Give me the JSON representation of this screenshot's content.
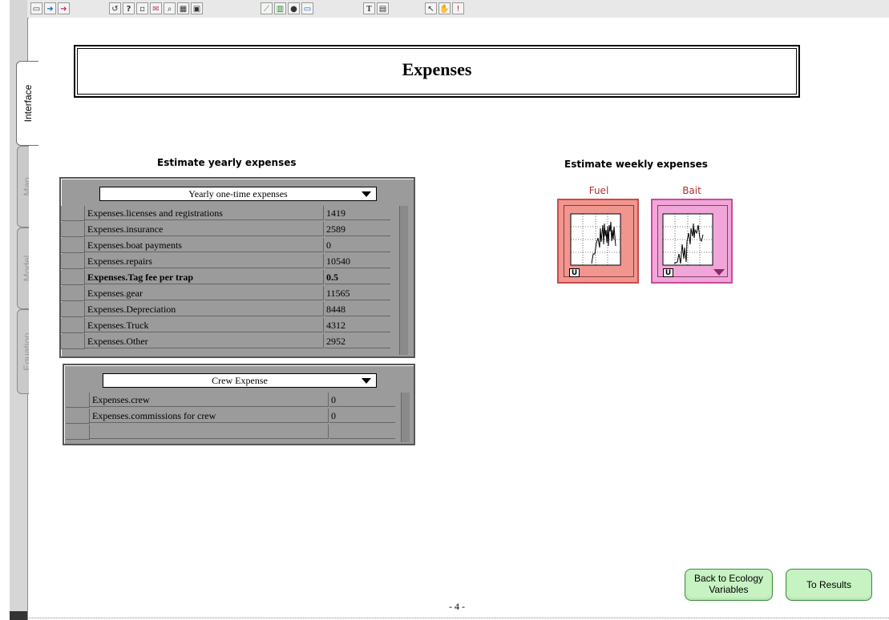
{
  "tabs": [
    {
      "label": "Interface",
      "active": true
    },
    {
      "label": "Map",
      "active": false
    },
    {
      "label": "Model",
      "active": false
    },
    {
      "label": "Equation",
      "active": false
    }
  ],
  "title": "Expenses",
  "yearly": {
    "heading": "Estimate yearly expenses",
    "selector": "Yearly one-time expenses",
    "rows": [
      {
        "name": "Expenses.licenses and registrations",
        "value": "1419"
      },
      {
        "name": "Expenses.insurance",
        "value": "2589"
      },
      {
        "name": "Expenses.boat payments",
        "value": "0"
      },
      {
        "name": "Expenses.repairs",
        "value": "10540"
      },
      {
        "name": "Expenses.Tag fee per trap",
        "value": "0.5"
      },
      {
        "name": "Expenses.gear",
        "value": "11565"
      },
      {
        "name": "Expenses.Depreciation",
        "value": "8448"
      },
      {
        "name": "Expenses.Truck",
        "value": "4312"
      },
      {
        "name": "Expenses.Other",
        "value": "2952"
      }
    ]
  },
  "crew": {
    "selector": "Crew Expense",
    "rows": [
      {
        "name": "Expenses.crew",
        "value": "0"
      },
      {
        "name": "Expenses.commissions for crew",
        "value": "0"
      }
    ]
  },
  "weekly": {
    "heading": "Estimate weekly expenses",
    "fuel_label": "Fuel",
    "bait_label": "Bait",
    "u_label": "U"
  },
  "buttons": {
    "back": "Back to Ecology Variables",
    "results": "To Results"
  },
  "page_number": "- 4 -",
  "colors": {
    "fuel_pad": "#f0968f",
    "bait_pad": "#f0a6d8",
    "button_green": "#c7f2c2",
    "table_gray": "#9b9b9b"
  }
}
